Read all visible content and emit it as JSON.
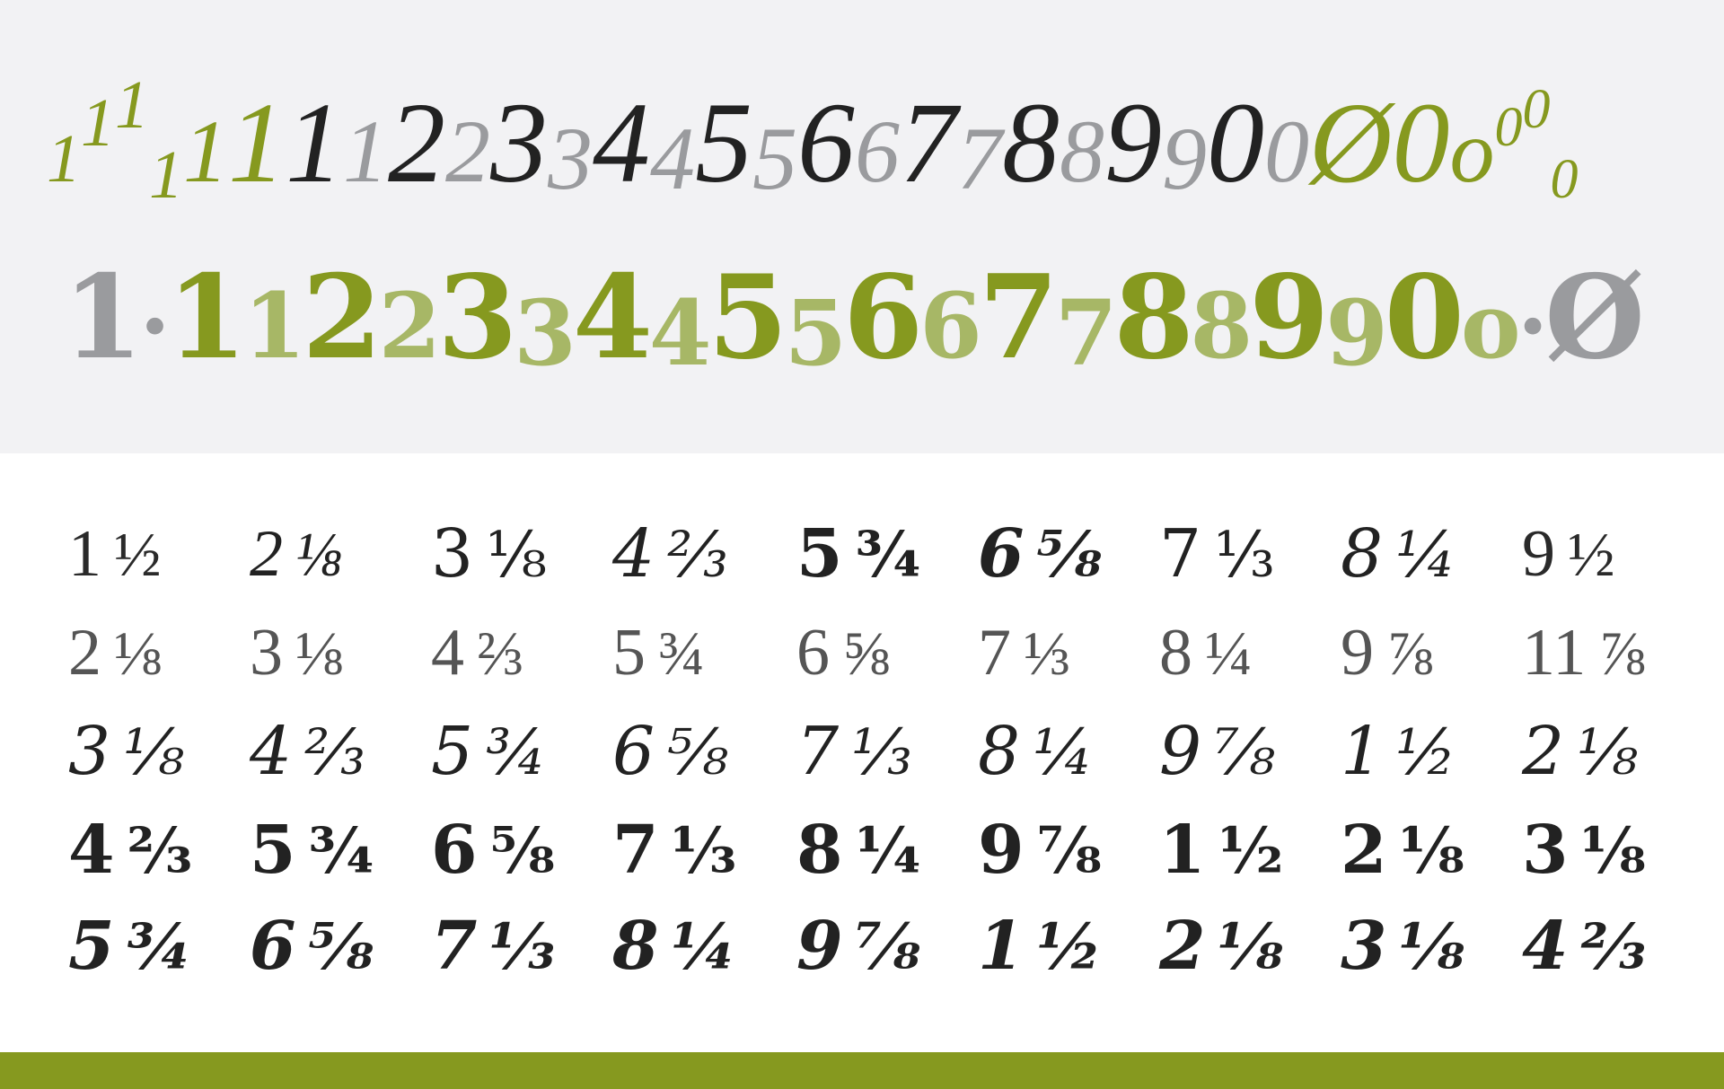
{
  "colors": {
    "green": "#86991f",
    "light_green": "#a7b766",
    "black": "#222222",
    "gray": "#9a9b9e",
    "panel": "#f2f2f4"
  },
  "row_a": [
    {
      "t": "1",
      "c": "green",
      "z": "small",
      "p": ""
    },
    {
      "t": "1",
      "c": "green",
      "z": "small",
      "p": "sup"
    },
    {
      "t": "1",
      "c": "green",
      "z": "small",
      "p": "suphi"
    },
    {
      "t": "1",
      "c": "green",
      "z": "small",
      "p": "sub"
    },
    {
      "t": "1",
      "c": "green",
      "z": "mid",
      "p": ""
    },
    {
      "t": "1",
      "c": "green",
      "z": "big",
      "p": ""
    },
    {
      "t": "1",
      "c": "black",
      "z": "big",
      "p": ""
    },
    {
      "t": "1",
      "c": "gray",
      "z": "mid",
      "p": ""
    },
    {
      "t": "2",
      "c": "black",
      "z": "big",
      "p": ""
    },
    {
      "t": "2",
      "c": "gray",
      "z": "mid",
      "p": ""
    },
    {
      "t": "3",
      "c": "black",
      "z": "big",
      "p": ""
    },
    {
      "t": "3",
      "c": "gray",
      "z": "mid",
      "p": "low"
    },
    {
      "t": "4",
      "c": "black",
      "z": "big",
      "p": ""
    },
    {
      "t": "4",
      "c": "gray",
      "z": "mid",
      "p": "low"
    },
    {
      "t": "5",
      "c": "black",
      "z": "big",
      "p": ""
    },
    {
      "t": "5",
      "c": "gray",
      "z": "mid",
      "p": "low"
    },
    {
      "t": "6",
      "c": "black",
      "z": "big",
      "p": ""
    },
    {
      "t": "6",
      "c": "gray",
      "z": "mid",
      "p": ""
    },
    {
      "t": "7",
      "c": "black",
      "z": "big",
      "p": ""
    },
    {
      "t": "7",
      "c": "gray",
      "z": "mid",
      "p": "low"
    },
    {
      "t": "8",
      "c": "black",
      "z": "big",
      "p": ""
    },
    {
      "t": "8",
      "c": "gray",
      "z": "mid",
      "p": ""
    },
    {
      "t": "9",
      "c": "black",
      "z": "big",
      "p": ""
    },
    {
      "t": "9",
      "c": "gray",
      "z": "mid",
      "p": "low"
    },
    {
      "t": "0",
      "c": "black",
      "z": "big",
      "p": ""
    },
    {
      "t": "0",
      "c": "gray",
      "z": "mid",
      "p": ""
    },
    {
      "t": "Ø",
      "c": "green",
      "z": "big",
      "p": ""
    },
    {
      "t": "0",
      "c": "green",
      "z": "big",
      "p": ""
    },
    {
      "t": "o",
      "c": "green",
      "z": "mid",
      "p": ""
    },
    {
      "t": "0",
      "c": "green",
      "z": "tiny",
      "p": "sup"
    },
    {
      "t": "0",
      "c": "green",
      "z": "tiny",
      "p": "suphi"
    },
    {
      "t": "0",
      "c": "green",
      "z": "tiny",
      "p": "sub"
    }
  ],
  "row_b": [
    {
      "t": "1",
      "c": "gray",
      "z": "big",
      "p": ""
    },
    {
      "t": "·",
      "c": "gray",
      "z": "mid",
      "p": ""
    },
    {
      "t": "1",
      "c": "green",
      "z": "big",
      "p": ""
    },
    {
      "t": "1",
      "c": "lgreen",
      "z": "mid",
      "p": ""
    },
    {
      "t": "2",
      "c": "green",
      "z": "big",
      "p": ""
    },
    {
      "t": "2",
      "c": "lgreen",
      "z": "mid",
      "p": ""
    },
    {
      "t": "3",
      "c": "green",
      "z": "big",
      "p": ""
    },
    {
      "t": "3",
      "c": "lgreen",
      "z": "mid",
      "p": "low"
    },
    {
      "t": "4",
      "c": "green",
      "z": "big",
      "p": ""
    },
    {
      "t": "4",
      "c": "lgreen",
      "z": "mid",
      "p": "low"
    },
    {
      "t": "5",
      "c": "green",
      "z": "big",
      "p": ""
    },
    {
      "t": "5",
      "c": "lgreen",
      "z": "mid",
      "p": "low"
    },
    {
      "t": "6",
      "c": "green",
      "z": "big",
      "p": ""
    },
    {
      "t": "6",
      "c": "lgreen",
      "z": "mid",
      "p": ""
    },
    {
      "t": "7",
      "c": "green",
      "z": "big",
      "p": ""
    },
    {
      "t": "7",
      "c": "lgreen",
      "z": "mid",
      "p": "low"
    },
    {
      "t": "8",
      "c": "green",
      "z": "big",
      "p": ""
    },
    {
      "t": "8",
      "c": "lgreen",
      "z": "mid",
      "p": ""
    },
    {
      "t": "9",
      "c": "green",
      "z": "big",
      "p": ""
    },
    {
      "t": "9",
      "c": "lgreen",
      "z": "mid",
      "p": "low"
    },
    {
      "t": "0",
      "c": "green",
      "z": "big",
      "p": ""
    },
    {
      "t": "o",
      "c": "lgreen",
      "z": "mid",
      "p": ""
    },
    {
      "t": "·",
      "c": "gray",
      "z": "mid",
      "p": ""
    },
    {
      "t": "Ø",
      "c": "gray",
      "z": "big",
      "p": ""
    }
  ],
  "fraction_rows": [
    {
      "cells": [
        {
          "n": "1",
          "f": "½",
          "v": "light"
        },
        {
          "n": "2",
          "f": "⅛",
          "v": "light-italic"
        },
        {
          "n": "3",
          "f": "⅛",
          "v": "regular"
        },
        {
          "n": "4",
          "f": "⅔",
          "v": "italic"
        },
        {
          "n": "5",
          "f": "¾",
          "v": "bold"
        },
        {
          "n": "6",
          "f": "⅝",
          "v": "bold-italic"
        },
        {
          "n": "7",
          "f": "⅓",
          "v": "regular"
        },
        {
          "n": "8",
          "f": "¼",
          "v": "italic"
        },
        {
          "n": "9",
          "f": "½",
          "v": "light"
        }
      ]
    },
    {
      "cells": [
        {
          "n": "2",
          "f": "⅛",
          "v": "thin"
        },
        {
          "n": "3",
          "f": "⅛",
          "v": "thin"
        },
        {
          "n": "4",
          "f": "⅔",
          "v": "thin"
        },
        {
          "n": "5",
          "f": "¾",
          "v": "thin"
        },
        {
          "n": "6",
          "f": "⅝",
          "v": "thin"
        },
        {
          "n": "7",
          "f": "⅓",
          "v": "thin"
        },
        {
          "n": "8",
          "f": "¼",
          "v": "thin"
        },
        {
          "n": "9",
          "f": "⅞",
          "v": "thin"
        },
        {
          "n": "11",
          "f": "⅞",
          "v": "thin"
        }
      ]
    },
    {
      "cells": [
        {
          "n": "3",
          "f": "⅛",
          "v": "italic"
        },
        {
          "n": "4",
          "f": "⅔",
          "v": "italic"
        },
        {
          "n": "5",
          "f": "¾",
          "v": "italic"
        },
        {
          "n": "6",
          "f": "⅝",
          "v": "italic"
        },
        {
          "n": "7",
          "f": "⅓",
          "v": "italic"
        },
        {
          "n": "8",
          "f": "¼",
          "v": "italic"
        },
        {
          "n": "9",
          "f": "⅞",
          "v": "italic"
        },
        {
          "n": "1",
          "f": "½",
          "v": "italic"
        },
        {
          "n": "2",
          "f": "⅛",
          "v": "italic"
        }
      ]
    },
    {
      "cells": [
        {
          "n": "4",
          "f": "⅔",
          "v": "bold"
        },
        {
          "n": "5",
          "f": "¾",
          "v": "bold"
        },
        {
          "n": "6",
          "f": "⅝",
          "v": "bold"
        },
        {
          "n": "7",
          "f": "⅓",
          "v": "bold"
        },
        {
          "n": "8",
          "f": "¼",
          "v": "bold"
        },
        {
          "n": "9",
          "f": "⅞",
          "v": "bold"
        },
        {
          "n": "1",
          "f": "½",
          "v": "bold"
        },
        {
          "n": "2",
          "f": "⅛",
          "v": "bold"
        },
        {
          "n": "3",
          "f": "⅛",
          "v": "bold"
        }
      ]
    },
    {
      "cells": [
        {
          "n": "5",
          "f": "¾",
          "v": "bold-italic"
        },
        {
          "n": "6",
          "f": "⅝",
          "v": "bold-italic"
        },
        {
          "n": "7",
          "f": "⅓",
          "v": "bold-italic"
        },
        {
          "n": "8",
          "f": "¼",
          "v": "bold-italic"
        },
        {
          "n": "9",
          "f": "⅞",
          "v": "bold-italic"
        },
        {
          "n": "1",
          "f": "½",
          "v": "bold-italic"
        },
        {
          "n": "2",
          "f": "⅛",
          "v": "bold-italic"
        },
        {
          "n": "3",
          "f": "⅛",
          "v": "bold-italic"
        },
        {
          "n": "4",
          "f": "⅔",
          "v": "bold-italic"
        }
      ]
    }
  ]
}
